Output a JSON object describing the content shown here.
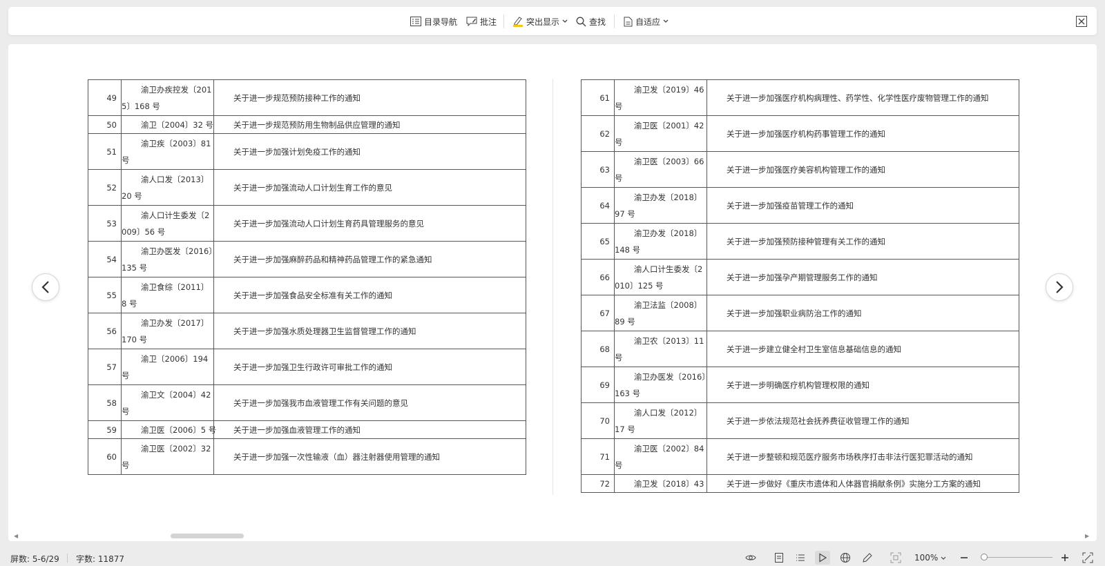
{
  "toolbar": {
    "toc_nav": "目录导航",
    "annotate": "批注",
    "highlight": "突出显示",
    "find": "查找",
    "fit": "自适应"
  },
  "left_table": [
    {
      "num": "49",
      "code": "渝卫办疾控发〔2015〕168 号",
      "title": "关于进一步规范预防接种工作的通知"
    },
    {
      "num": "50",
      "code": "渝卫〔2004〕32 号",
      "title": "关于进一步规范预防用生物制品供应管理的通知"
    },
    {
      "num": "51",
      "code": "渝卫疾〔2003〕81 号",
      "title": "关于进一步加强计划免疫工作的通知"
    },
    {
      "num": "52",
      "code": "渝人口发〔2013〕20 号",
      "title": "关于进一步加强流动人口计划生育工作的意见"
    },
    {
      "num": "53",
      "code": "渝人口计生委发〔2009〕56 号",
      "title": "关于进一步加强流动人口计划生育药具管理服务的意见"
    },
    {
      "num": "54",
      "code": "渝卫办医发〔2016〕135 号",
      "title": "关于进一步加强麻醉药品和精神药品管理工作的紧急通知"
    },
    {
      "num": "55",
      "code": "渝卫食综〔2011〕8 号",
      "title": "关于进一步加强食品安全标准有关工作的通知"
    },
    {
      "num": "56",
      "code": "渝卫办发〔2017〕170 号",
      "title": "关于进一步加强水质处理器卫生监督管理工作的通知"
    },
    {
      "num": "57",
      "code": "渝卫〔2006〕194 号",
      "title": "关于进一步加强卫生行政许可审批工作的通知"
    },
    {
      "num": "58",
      "code": "渝卫文〔2004〕42 号",
      "title": "关于进一步加强我市血液管理工作有关问题的意见"
    },
    {
      "num": "59",
      "code": "渝卫医〔2006〕5 号",
      "title": "关于进一步加强血液管理工作的通知"
    },
    {
      "num": "60",
      "code": "渝卫医〔2002〕32 号",
      "title": "关于进一步加强一次性输液（血）器注射器使用管理的通知"
    }
  ],
  "right_table": [
    {
      "num": "61",
      "code": "渝卫发〔2019〕46 号",
      "title": "关于进一步加强医疗机构病理性、药学性、化学性医疗废物管理工作的通知"
    },
    {
      "num": "62",
      "code": "渝卫医〔2001〕42 号",
      "title": "关于进一步加强医疗机构药事管理工作的通知"
    },
    {
      "num": "63",
      "code": "渝卫医〔2003〕66 号",
      "title": "关于进一步加强医疗美容机构管理工作的通知"
    },
    {
      "num": "64",
      "code": "渝卫办发〔2018〕97 号",
      "title": "关于进一步加强疫苗管理工作的通知"
    },
    {
      "num": "65",
      "code": "渝卫办发〔2018〕148 号",
      "title": "关于进一步加强预防接种管理有关工作的通知"
    },
    {
      "num": "66",
      "code": "渝人口计生委发〔2010〕125 号",
      "title": "关于进一步加强孕产期管理服务工作的通知"
    },
    {
      "num": "67",
      "code": "渝卫法监〔2008〕89 号",
      "title": "关于进一步加强职业病防治工作的通知"
    },
    {
      "num": "68",
      "code": "渝卫农〔2013〕11 号",
      "title": "关于进一步建立健全村卫生室信息基础信息的通知"
    },
    {
      "num": "69",
      "code": "渝卫办医发〔2016〕163 号",
      "title": "关于进一步明确医疗机构管理权限的通知"
    },
    {
      "num": "70",
      "code": "渝人口发〔2012〕17 号",
      "title": "关于进一步依法规范社会抚养费征收管理工作的通知"
    },
    {
      "num": "71",
      "code": "渝卫医〔2002〕84 号",
      "title": "关于进一步整顿和规范医疗服务市场秩序打击非法行医犯罪活动的通知"
    },
    {
      "num": "72",
      "code": "渝卫发〔2018〕43",
      "title": "关于进一步做好《重庆市遗体和人体器官捐献条例》实施分工方案的通知"
    }
  ],
  "status": {
    "pages": "屏数: 5-6/29",
    "words": "字数: 11877",
    "zoom": "100%"
  },
  "colors": {
    "background": "#ececec",
    "highlight_accent": "#f5c518"
  }
}
